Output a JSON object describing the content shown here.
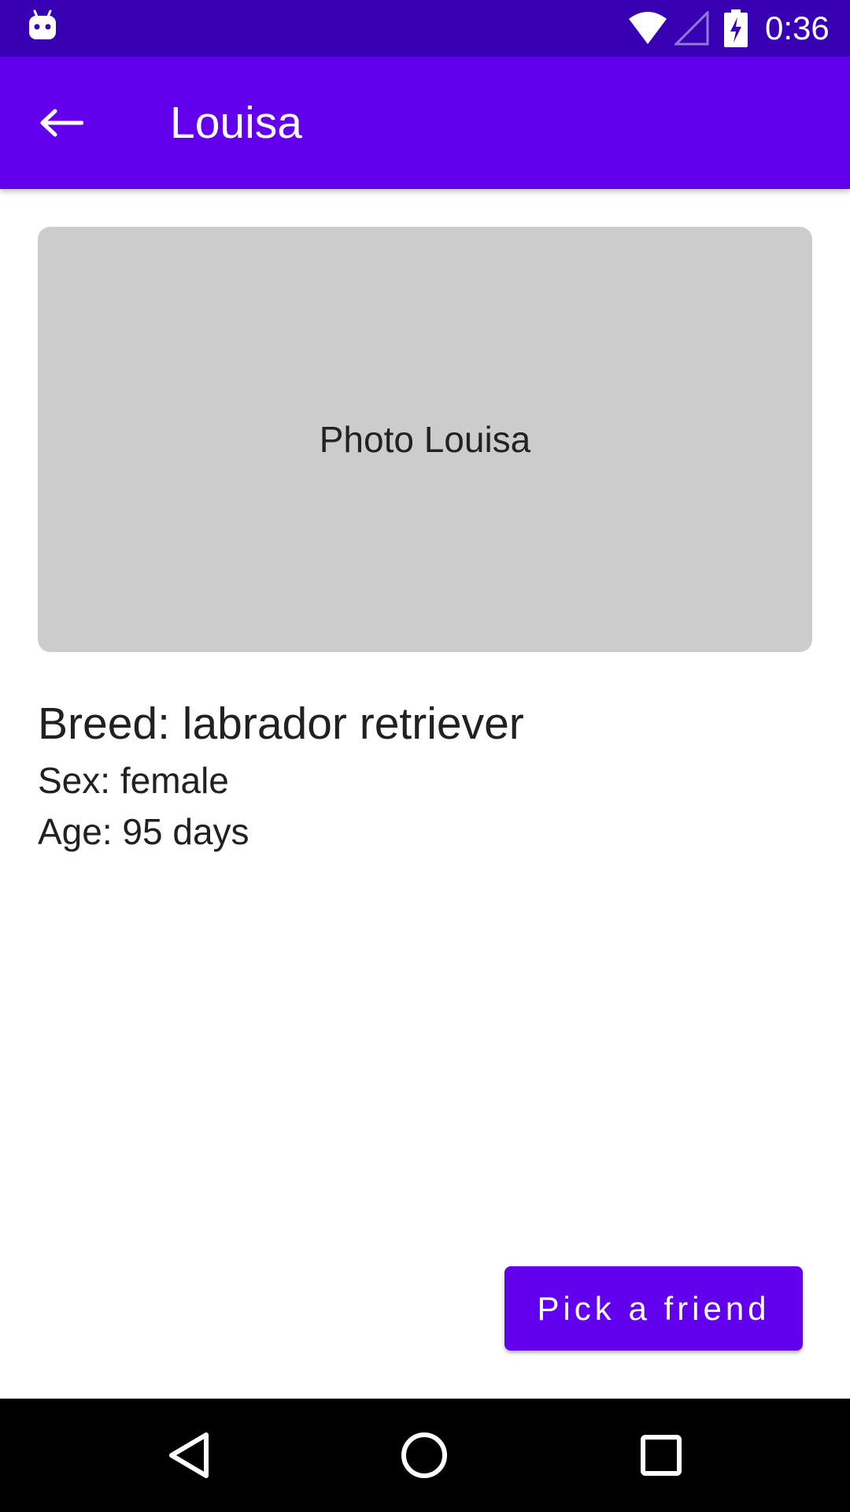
{
  "status_bar": {
    "time": "0:36",
    "icons": [
      "android-debug-icon",
      "wifi-icon",
      "cell-signal-icon",
      "battery-charging-icon"
    ]
  },
  "app_bar": {
    "title": "Louisa",
    "back_icon": "arrow-back-icon"
  },
  "photo": {
    "label": "Photo Louisa"
  },
  "details": {
    "breed": "Breed: labrador retriever",
    "sex": "Sex: female",
    "age": "Age: 95 days"
  },
  "actions": {
    "pick_friend_label": "Pick a friend"
  },
  "nav_bar": {
    "icons": [
      "nav-back-icon",
      "nav-home-icon",
      "nav-recents-icon"
    ]
  },
  "colors": {
    "status_bar": "#3700B3",
    "primary": "#6200EE",
    "photo_placeholder": "#CCCCCC"
  }
}
